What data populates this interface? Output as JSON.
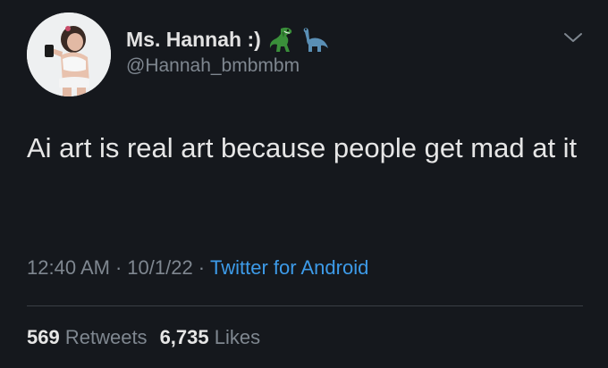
{
  "author": {
    "display_name": "Ms. Hannah :)",
    "handle": "@Hannah_bmbmbm",
    "emojis": [
      "t-rex-emoji",
      "sauropod-emoji"
    ]
  },
  "tweet": {
    "text": "Ai art is real art because people get mad at it"
  },
  "meta": {
    "time": "12:40 AM",
    "date": "10/1/22",
    "separator": "·",
    "source": "Twitter for Android"
  },
  "stats": {
    "retweets_count": "569",
    "retweets_label": "Retweets",
    "likes_count": "6,735",
    "likes_label": "Likes"
  },
  "colors": {
    "background": "#15181d",
    "text": "#e6e6e6",
    "secondary_text": "#7f8790",
    "link": "#3d9be9",
    "divider": "#3a3f45"
  }
}
